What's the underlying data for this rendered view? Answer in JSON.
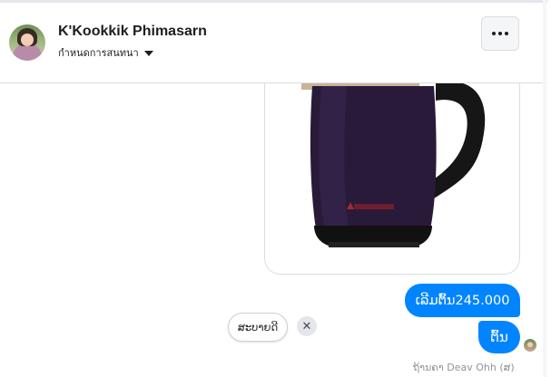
{
  "header": {
    "contact_name": "K'Kookkik Phimasarn",
    "conversation_settings_label": "กำหนดการสนทนา"
  },
  "messages": {
    "price_message": "ເລີມຕົ້ນ245.000",
    "short_message": "ຕົ້ນ",
    "seen_text": "ຖ້ານຄາ Deav Ohh (ສ)"
  },
  "quick_reply": {
    "label": "ສະບາຍດີ"
  },
  "colors": {
    "accent": "#0084ff",
    "kettle_body": "#2a1a3a",
    "text": "#1c1e21"
  },
  "icons": {
    "more": "more-icon",
    "caret": "caret-down-icon",
    "close": "close-icon"
  }
}
